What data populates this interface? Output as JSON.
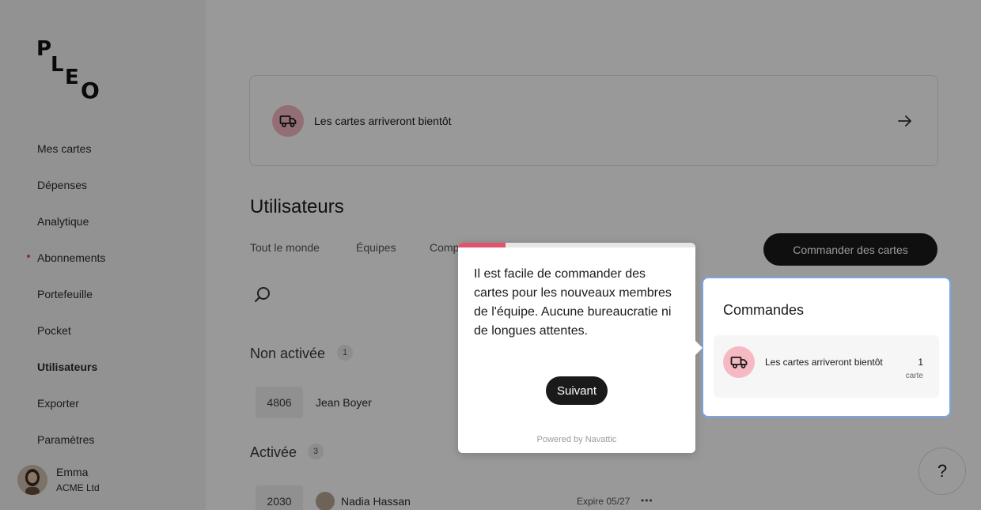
{
  "brand": {
    "logo_letters": [
      "P",
      "L",
      "E",
      "O"
    ]
  },
  "sidebar": {
    "items": [
      {
        "label": "Mes cartes"
      },
      {
        "label": "Dépenses"
      },
      {
        "label": "Analytique"
      },
      {
        "label": "Abonnements",
        "has_dot": true
      },
      {
        "label": "Portefeuille"
      },
      {
        "label": "Pocket"
      },
      {
        "label": "Utilisateurs",
        "active": true
      },
      {
        "label": "Exporter"
      },
      {
        "label": "Paramètres"
      }
    ],
    "user": {
      "name": "Emma",
      "company": "ACME Ltd"
    }
  },
  "banner": {
    "text": "Les cartes arriveront bientôt",
    "icon": "truck-icon",
    "arrow_icon": "arrow-right-icon"
  },
  "users": {
    "title": "Utilisateurs",
    "tabs": [
      "Tout le monde",
      "Équipes",
      "Comp"
    ],
    "order_button": "Commander des cartes",
    "groups": {
      "inactive": {
        "label": "Non activée",
        "count": "1",
        "row": {
          "card": "4806",
          "name": "Jean Boyer"
        }
      },
      "active": {
        "label": "Activée",
        "count": "3",
        "row": {
          "card": "2030",
          "name": "Nadia Hassan",
          "expire": "Expire 05/27",
          "menu": "•••"
        }
      }
    }
  },
  "orders": {
    "title": "Commandes",
    "row": {
      "text": "Les cartes arriveront bientôt",
      "count": "1",
      "unit": "carte"
    }
  },
  "popover": {
    "text": "Il est facile de commander des cartes pour les nouveaux membres de l'équipe. Aucune bureaucratie ni de longues attentes.",
    "next_button": "Suivant",
    "powered": "Powered by Navattic",
    "progress_fraction": 0.2
  },
  "help": {
    "label": "?"
  },
  "colors": {
    "accent": "#e0536c",
    "icon_bg": "#f6b9c4",
    "highlight": "#79a6e6",
    "dark": "#1a1a1a"
  }
}
